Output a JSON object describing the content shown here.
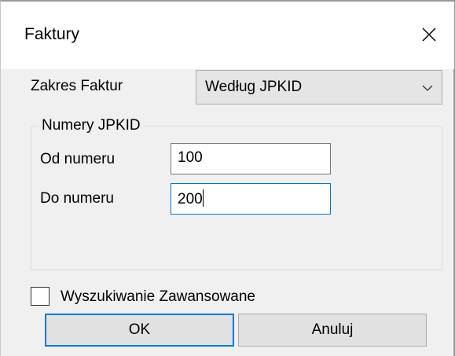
{
  "dialog": {
    "title": "Faktury",
    "close_icon": "close-icon"
  },
  "invoice_range": {
    "label": "Zakres Faktur",
    "selected": "Według JPKID",
    "dropdown_icon": "chevron-down-icon"
  },
  "jpkid_group": {
    "title": "Numery JPKID",
    "from_label": "Od numeru",
    "from_value": "100",
    "to_label": "Do numeru",
    "to_value": "200"
  },
  "advanced_search": {
    "label": "Wyszukiwanie Zawansowane",
    "checked": false
  },
  "buttons": {
    "ok": "OK",
    "cancel": "Anuluj"
  }
}
